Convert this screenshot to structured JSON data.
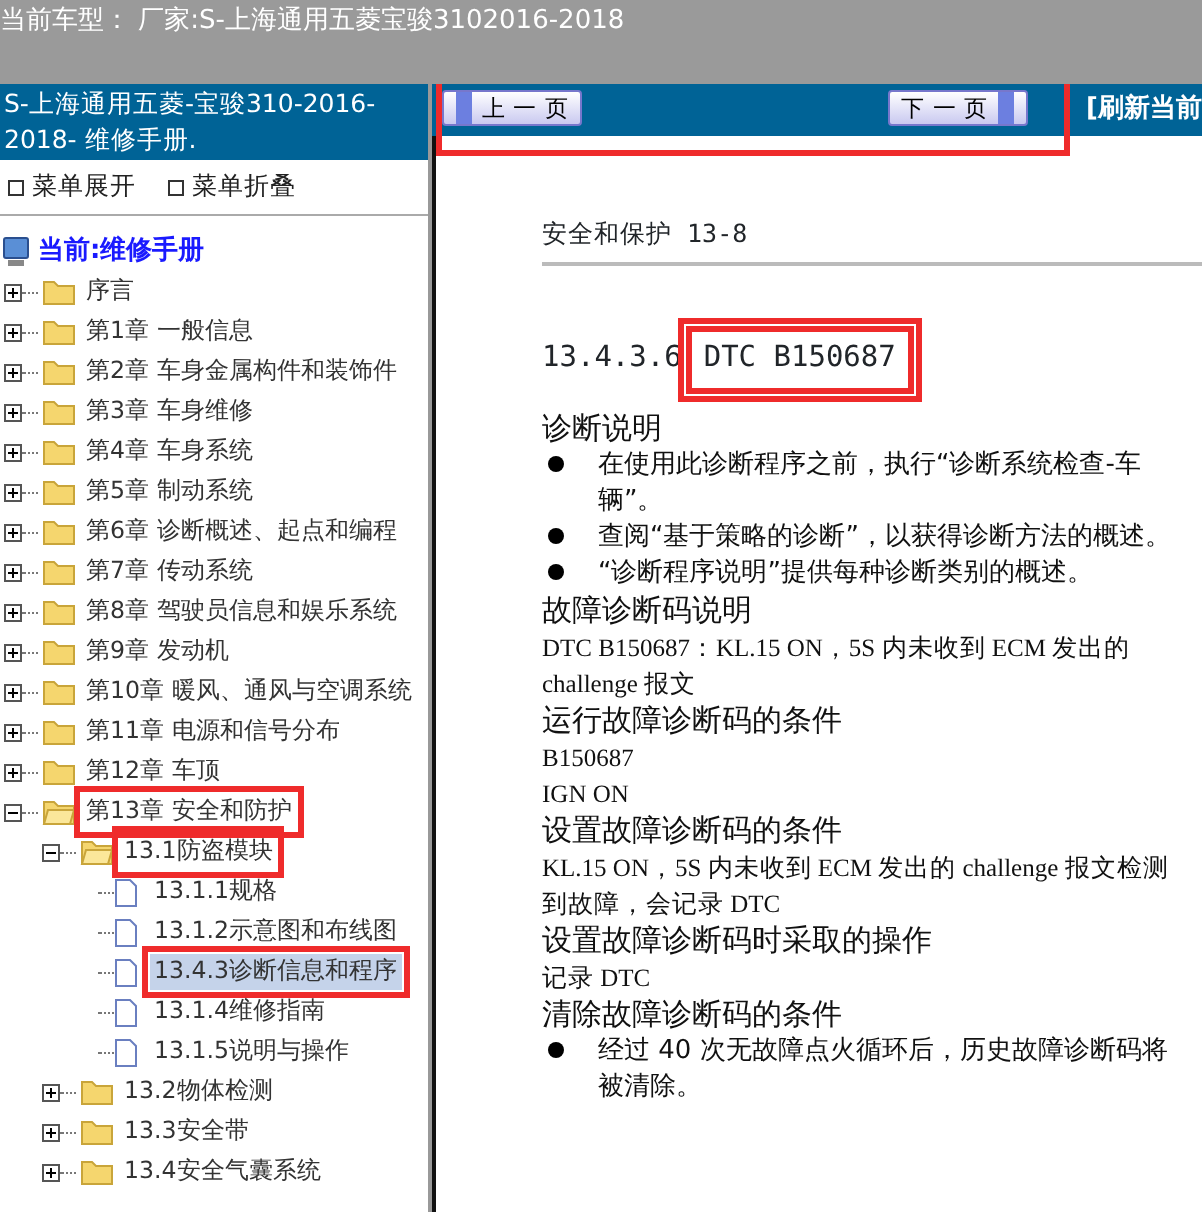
{
  "app_bar": {
    "vehicle": "当前车型： 厂家:S-上海通用五菱宝骏3102016-2018"
  },
  "sidebar": {
    "title": "S-上海通用五菱-宝骏310-2016-2018- 维修手册.",
    "menu_actions": [
      {
        "label": "菜单展开"
      },
      {
        "label": "菜单折叠"
      }
    ],
    "tree": {
      "label": "当前:维修手册",
      "children": [
        {
          "label": "序言",
          "kind": "folder",
          "expanded": false,
          "selected": false,
          "highlighted": false
        },
        {
          "label": "第1章 一般信息",
          "kind": "folder",
          "expanded": false,
          "selected": false,
          "highlighted": false
        },
        {
          "label": "第2章 车身金属构件和装饰件",
          "kind": "folder",
          "expanded": false,
          "selected": false,
          "highlighted": false
        },
        {
          "label": "第3章 车身维修",
          "kind": "folder",
          "expanded": false,
          "selected": false,
          "highlighted": false
        },
        {
          "label": "第4章 车身系统",
          "kind": "folder",
          "expanded": false,
          "selected": false,
          "highlighted": false
        },
        {
          "label": "第5章 制动系统",
          "kind": "folder",
          "expanded": false,
          "selected": false,
          "highlighted": false
        },
        {
          "label": "第6章 诊断概述、起点和编程",
          "kind": "folder",
          "expanded": false,
          "selected": false,
          "highlighted": false
        },
        {
          "label": "第7章 传动系统",
          "kind": "folder",
          "expanded": false,
          "selected": false,
          "highlighted": false
        },
        {
          "label": "第8章 驾驶员信息和娱乐系统",
          "kind": "folder",
          "expanded": false,
          "selected": false,
          "highlighted": false
        },
        {
          "label": "第9章 发动机",
          "kind": "folder",
          "expanded": false,
          "selected": false,
          "highlighted": false
        },
        {
          "label": "第10章 暖风、通风与空调系统",
          "kind": "folder",
          "expanded": false,
          "selected": false,
          "highlighted": false
        },
        {
          "label": "第11章 电源和信号分布",
          "kind": "folder",
          "expanded": false,
          "selected": false,
          "highlighted": false
        },
        {
          "label": "第12章 车顶",
          "kind": "folder",
          "expanded": false,
          "selected": false,
          "highlighted": false
        },
        {
          "label": "第13章 安全和防护",
          "kind": "folder",
          "expanded": true,
          "selected": false,
          "highlighted": true,
          "children": [
            {
              "label": "13.1防盗模块",
              "kind": "folder",
              "expanded": true,
              "selected": false,
              "highlighted": true,
              "children": [
                {
                  "label": "13.1.1规格",
                  "kind": "page",
                  "selected": false,
                  "highlighted": false
                },
                {
                  "label": "13.1.2示意图和布线图",
                  "kind": "page",
                  "selected": false,
                  "highlighted": false
                },
                {
                  "label": "13.4.3诊断信息和程序",
                  "kind": "page",
                  "selected": true,
                  "highlighted": true
                },
                {
                  "label": "13.1.4维修指南",
                  "kind": "page",
                  "selected": false,
                  "highlighted": false
                },
                {
                  "label": "13.1.5说明与操作",
                  "kind": "page",
                  "selected": false,
                  "highlighted": false
                }
              ]
            },
            {
              "label": "13.2物体检测",
              "kind": "folder",
              "expanded": false,
              "selected": false,
              "highlighted": false
            },
            {
              "label": "13.3安全带",
              "kind": "folder",
              "expanded": false,
              "selected": false,
              "highlighted": false
            },
            {
              "label": "13.4安全气囊系统",
              "kind": "folder",
              "expanded": false,
              "selected": false,
              "highlighted": false
            }
          ]
        }
      ]
    }
  },
  "toolbar": {
    "prev": "上 一 页",
    "next": "下 一 页",
    "refresh": "[刷新当前",
    "highlighted": true
  },
  "document": {
    "running_header": "安全和保护 13-8",
    "title": {
      "number": "13.4.3.6",
      "code": "DTC B150687",
      "highlighted": true
    },
    "blocks": [
      {
        "kind": "heading",
        "text": "诊断说明"
      },
      {
        "kind": "bullet",
        "text": "在使用此诊断程序之前，执行“诊断系统检查-车辆”。"
      },
      {
        "kind": "bullet",
        "text": "查阅“基于策略的诊断”，以获得诊断方法的概述。"
      },
      {
        "kind": "bullet",
        "text": "“诊断程序说明”提供每种诊断类别的概述。"
      },
      {
        "kind": "heading",
        "text": "故障诊断码说明"
      },
      {
        "kind": "para",
        "text": "DTC B150687：KL.15 ON，5S 内未收到 ECM 发出的 challenge 报文"
      },
      {
        "kind": "heading",
        "text": "运行故障诊断码的条件"
      },
      {
        "kind": "para",
        "text": "B150687"
      },
      {
        "kind": "para",
        "text": "IGN ON"
      },
      {
        "kind": "heading",
        "text": "设置故障诊断码的条件"
      },
      {
        "kind": "para",
        "text": "KL.15 ON，5S 内未收到 ECM 发出的 challenge 报文检测到故障，会记录 DTC"
      },
      {
        "kind": "heading",
        "text": "设置故障诊断码时采取的操作"
      },
      {
        "kind": "para",
        "text": "记录 DTC"
      },
      {
        "kind": "heading",
        "text": "清除故障诊断码的条件"
      },
      {
        "kind": "bullet",
        "text": "经过 40 次无故障点火循环后，历史故障诊断码将被清除。"
      }
    ]
  }
}
